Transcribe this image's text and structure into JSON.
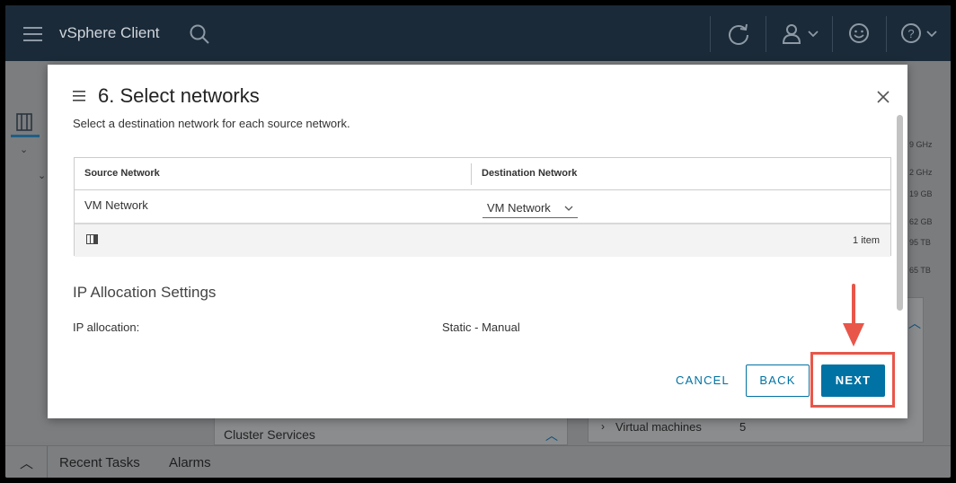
{
  "app": {
    "title": "vSphere Client",
    "icons": [
      "menu-icon",
      "search-icon",
      "refresh-icon",
      "user-icon",
      "smiley-icon",
      "help-icon"
    ]
  },
  "background": {
    "right_stats": [
      "9 GHz",
      "2 GHz",
      "19 GB",
      "62 GB",
      "95 TB",
      "65 TB"
    ],
    "cluster_services": "Cluster Services",
    "virtual_machines_label": "Virtual machines",
    "virtual_machines_count": "5"
  },
  "bottom_bar": {
    "recent_tasks": "Recent Tasks",
    "alarms": "Alarms"
  },
  "dialog": {
    "title": "6. Select networks",
    "subtitle": "Select a destination network for each source network.",
    "table": {
      "columns": [
        "Source Network",
        "Destination Network"
      ],
      "rows": [
        {
          "source": "VM Network",
          "destination": "VM Network"
        }
      ],
      "footer_count": "1 item"
    },
    "ip_section": {
      "title": "IP Allocation Settings",
      "label": "IP allocation:",
      "value": "Static - Manual"
    },
    "buttons": {
      "cancel": "CANCEL",
      "back": "BACK",
      "next": "NEXT"
    }
  },
  "colors": {
    "topbar": "#1b2a38",
    "accent": "#0072a3",
    "annotation": "#e8564a"
  }
}
